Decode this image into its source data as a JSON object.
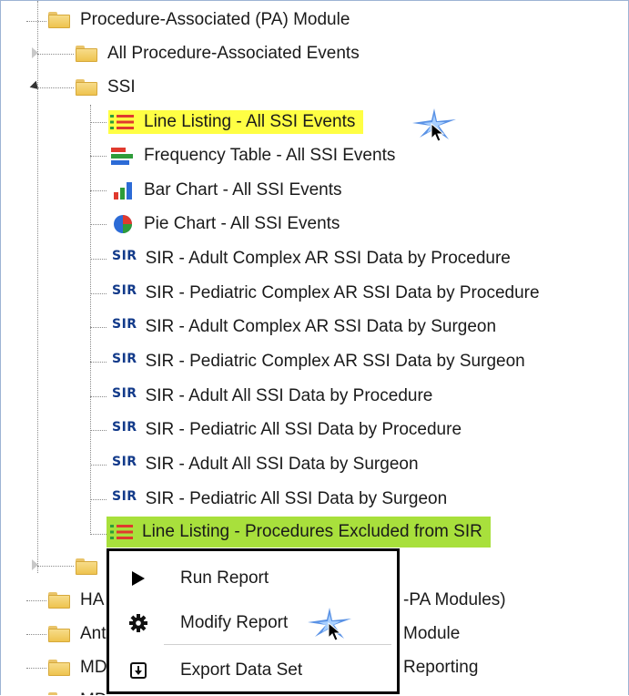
{
  "tree": {
    "root_label": "Procedure-Associated (PA) Module",
    "all_events_label": "All Procedure-Associated Events",
    "ssi_label": "SSI",
    "ssi_items": [
      {
        "icon": "line-listing-icon",
        "label": "Line Listing - All SSI Events"
      },
      {
        "icon": "frequency-table-icon",
        "label": "Frequency Table - All SSI Events"
      },
      {
        "icon": "bar-chart-icon",
        "label": "Bar Chart - All SSI Events"
      },
      {
        "icon": "pie-chart-icon",
        "label": "Pie Chart - All SSI Events"
      },
      {
        "icon": "sir-icon",
        "icon_text": "SIR",
        "label": "SIR - Adult Complex AR SSI Data by Procedure"
      },
      {
        "icon": "sir-icon",
        "icon_text": "SIR",
        "label": "SIR - Pediatric Complex AR SSI Data by Procedure"
      },
      {
        "icon": "sir-icon",
        "icon_text": "SIR",
        "label": "SIR - Adult Complex AR SSI Data by Surgeon"
      },
      {
        "icon": "sir-icon",
        "icon_text": "SIR",
        "label": "SIR - Pediatric Complex AR SSI Data by Surgeon"
      },
      {
        "icon": "sir-icon",
        "icon_text": "SIR",
        "label": "SIR - Adult All SSI Data by Procedure"
      },
      {
        "icon": "sir-icon",
        "icon_text": "SIR",
        "label": "SIR - Pediatric All SSI Data by Procedure"
      },
      {
        "icon": "sir-icon",
        "icon_text": "SIR",
        "label": "SIR - Adult All SSI Data by Surgeon"
      },
      {
        "icon": "sir-icon",
        "icon_text": "SIR",
        "label": "SIR - Pediatric All SSI Data by Surgeon"
      },
      {
        "icon": "line-listing-icon",
        "label": "Line Listing - Procedures Excluded from SIR"
      }
    ],
    "partial_rows": [
      {
        "left": "HA",
        "right": "-PA Modules)"
      },
      {
        "left": "Ant",
        "right": "Module"
      },
      {
        "left": "MD",
        "right": "Reporting"
      },
      {
        "left": "MD",
        "right": ""
      }
    ]
  },
  "context_menu": {
    "items": [
      {
        "icon": "play-icon",
        "label": "Run Report"
      },
      {
        "icon": "gear-icon",
        "label": "Modify Report"
      },
      {
        "icon": "export-icon",
        "label": "Export Data Set"
      }
    ]
  },
  "colors": {
    "highlight_yellow": "#ffff44",
    "highlight_green": "#a8e03c",
    "sir_blue": "#123a8a"
  }
}
